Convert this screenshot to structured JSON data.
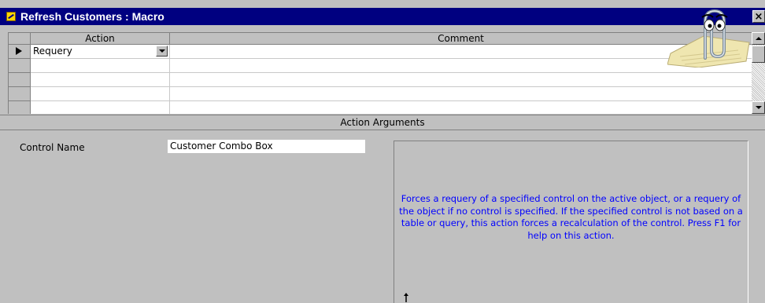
{
  "window": {
    "title": "Refresh Customers : Macro",
    "close_glyph": "×"
  },
  "grid": {
    "columns": [
      "Action",
      "Comment"
    ],
    "rows": [
      {
        "action": "Requery",
        "comment": "",
        "current": true
      },
      {
        "action": "",
        "comment": ""
      },
      {
        "action": "",
        "comment": ""
      },
      {
        "action": "",
        "comment": ""
      },
      {
        "action": "",
        "comment": ""
      }
    ]
  },
  "arguments": {
    "section_title": "Action Arguments",
    "control_name_label": "Control Name",
    "control_name_value": "Customer Combo Box",
    "help_text": "Forces a requery of a specified control on the active object, or a requery of the object if no control is specified. If the specified control is not based on a table or query, this action forces a recalculation of the control. Press F1 for help on this action."
  },
  "colors": {
    "title_bar": "#000080",
    "face": "#c0c0c0",
    "help_text": "#0000ff"
  },
  "icons": {
    "title_icon": "macro-icon",
    "assistant": "clippit-assistant-icon",
    "row_pointer": "current-row-arrow-icon"
  }
}
